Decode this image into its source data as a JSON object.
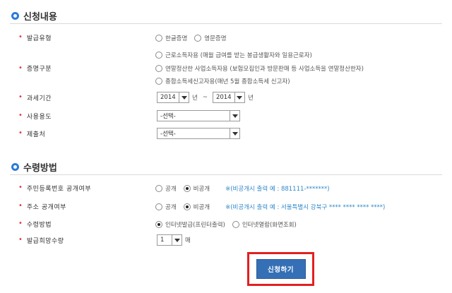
{
  "section1": {
    "title": "신청내용",
    "issue_type": {
      "label": "발급유형",
      "options": [
        "한글증명",
        "영문증명"
      ]
    },
    "cert_type": {
      "label": "증명구분",
      "options": [
        "근로소득자용 (매월 급여를 받는 봉급생활자와 일용근로자)",
        "연말정산한 사업소득자용 (보험모집인과 방문판매 등 사업소득을 연말정산한자)",
        "종합소득세신고자용(매년 5월 종합소득세 신고자)"
      ]
    },
    "tax_period": {
      "label": "과세기간",
      "from_year": "2014",
      "to_year": "2014",
      "year_unit": "년",
      "tilde": "~"
    },
    "usage": {
      "label": "사용용도",
      "value": "-선택-"
    },
    "submit_to": {
      "label": "제출처",
      "value": "-선택-"
    }
  },
  "section2": {
    "title": "수령방법",
    "rrn_disclosure": {
      "label": "주민등록번호 공개여부",
      "options": [
        "공개",
        "비공개"
      ],
      "note": "※(비공개시 출력 예 : 881111-*******)"
    },
    "address_disclosure": {
      "label": "주소 공개여부",
      "options": [
        "공개",
        "비공개"
      ],
      "note": "※(비공개시 출력 예 : 서울특별시 강북구 **** **** **** ****)"
    },
    "receive_method": {
      "label": "수령방법",
      "options": [
        "인터넷발급(프린터출력)",
        "인터넷열람(화면조회)"
      ]
    },
    "quantity": {
      "label": "발급희망수량",
      "value": "1",
      "unit": "매"
    }
  },
  "submit": {
    "label": "신청하기"
  },
  "colors": {
    "accent_blue": "#2b7bd8",
    "button_blue": "#3570b6",
    "highlight_red": "#e32020",
    "note_blue": "#2f88c8",
    "label_dot_red": "#e0334a"
  }
}
